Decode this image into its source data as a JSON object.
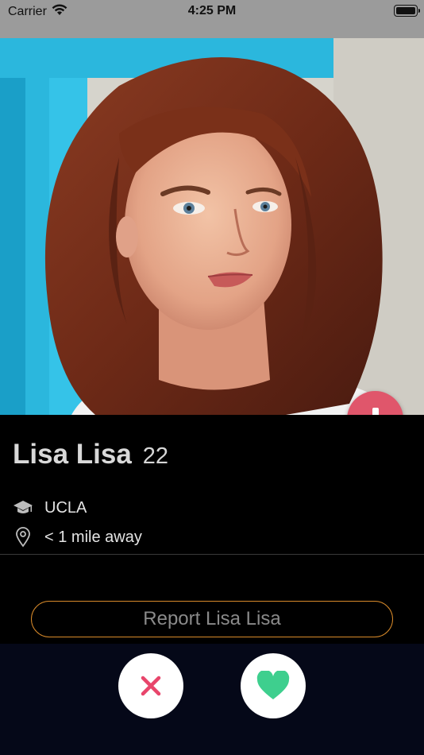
{
  "status_bar": {
    "carrier": "Carrier",
    "time": "4:25 PM"
  },
  "profile": {
    "name": "Lisa Lisa",
    "age": "22",
    "school": "UCLA",
    "distance": "< 1 mile away"
  },
  "report": {
    "label": "Report Lisa Lisa"
  },
  "colors": {
    "accent_red": "#e0566b",
    "like_green": "#3ecf8e",
    "dislike_pink": "#e8456b",
    "report_border": "#d88a2a"
  },
  "icons": {
    "wifi": "wifi-icon",
    "battery": "battery-icon",
    "collapse": "arrow-down-icon",
    "school": "graduation-cap-icon",
    "location": "location-pin-icon",
    "dislike": "close-icon",
    "like": "heart-icon"
  }
}
